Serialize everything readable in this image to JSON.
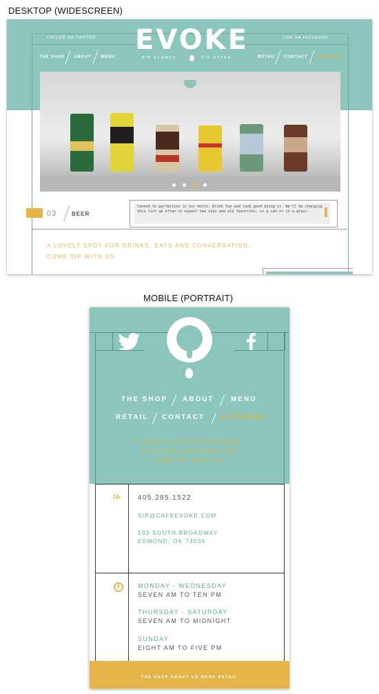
{
  "captions": {
    "desktop": "DESKTOP (WIDESCREEN)",
    "mobile": "MOBILE (PORTRAIT)"
  },
  "desktop": {
    "follow_twitter": "FOLLOW ON TWITTER",
    "like_facebook": "LIKE ON FACEBOOK",
    "logo": "EVOKE",
    "tag_left": "SIP SLOWLY",
    "tag_right": "SIP OFTEN",
    "nav_left": [
      "THE SHOP",
      "ABOUT",
      "MENU"
    ],
    "nav_right": [
      "RETAIL",
      "CONTACT",
      "CATERING"
    ],
    "slide_number": "03",
    "slide_label": "BEER",
    "slide_text": "Canned to perfection is our motto. Drink fun and look good doing it. We'll be changing this list up often so expect new sips and old favorites, in a can or in a glass.",
    "tagline_1": "A LOVELY SPOT FOR DRINKS, EATS AND CONVERSATION.",
    "tagline_2": "COME SIP WITH US."
  },
  "mobile": {
    "nav_row1": [
      "THE SHOP",
      "ABOUT",
      "MENU"
    ],
    "nav_row2": [
      "RETAIL",
      "CONTACT",
      "CATERING"
    ],
    "tagline_1": "A LOVELY SPOT FOR DRINKS,",
    "tagline_2": "EATS AND CONVERSATION.",
    "tagline_3": "COME SIP WITH US.",
    "number_symbol": "№",
    "phone": "405.285.1522",
    "email": "SIP@CAFEEVOKE.COM",
    "address_1": "103 SOUTH BROADWAY",
    "address_2": "EDMOND, OK 73034",
    "hours": [
      {
        "days": "MONDAY - WEDNESDAY",
        "time": "SEVEN AM TO TEN PM"
      },
      {
        "days": "THURSDAY - SATURDAY",
        "time": "SEVEN AM TO MIDNIGHT"
      },
      {
        "days": "SUNDAY",
        "time": "EIGHT AM TO FIVE PM"
      }
    ],
    "footer_nav": "THE SHOP   ABOUT US   MENU   RETAIL"
  },
  "icons": {
    "twitter": "twitter-bird-icon",
    "facebook": "facebook-f-icon",
    "clock": "clock-icon"
  },
  "colors": {
    "teal": "#8cc5bc",
    "gold": "#e6b54a",
    "teal_text": "#5aa89d"
  }
}
